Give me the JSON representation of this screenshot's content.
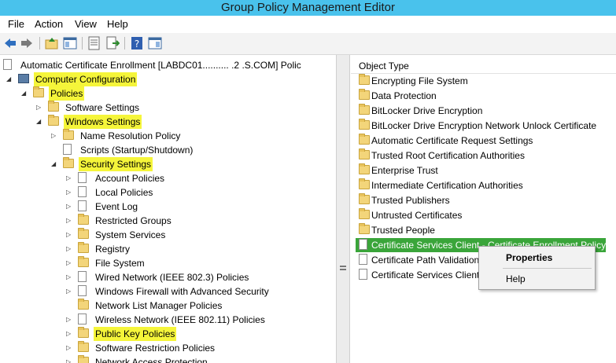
{
  "window": {
    "title": "Group Policy Management Editor"
  },
  "menu": [
    "File",
    "Action",
    "View",
    "Help"
  ],
  "toolbar": {
    "icons": [
      "back-icon",
      "forward-icon",
      "up-folder-icon",
      "show-hide-tree-icon",
      "properties-icon",
      "export-list-icon",
      "help-icon",
      "action-pane-icon"
    ]
  },
  "tree": {
    "root_label": "Automatic Certificate Enrollment [LABDC01.......... .2 .S.COM] Polic",
    "nodes": [
      {
        "label": "Computer Configuration",
        "highlight": true,
        "expanded": true,
        "icon": "computer-icon"
      },
      {
        "label": "Policies",
        "highlight": true,
        "expanded": true,
        "icon": "folder-icon"
      },
      {
        "label": "Software Settings",
        "highlight": false,
        "expanded": false,
        "icon": "folder-icon"
      },
      {
        "label": "Windows Settings",
        "highlight": true,
        "expanded": true,
        "icon": "folder-icon"
      },
      {
        "label": "Name Resolution Policy",
        "highlight": false,
        "expanded": false,
        "icon": "folder-icon"
      },
      {
        "label": "Scripts (Startup/Shutdown)",
        "highlight": false,
        "expanded": null,
        "icon": "script-icon"
      },
      {
        "label": "Security Settings",
        "highlight": true,
        "expanded": true,
        "icon": "security-icon"
      },
      {
        "label": "Account Policies",
        "highlight": false,
        "expanded": false,
        "icon": "policy-icon"
      },
      {
        "label": "Local Policies",
        "highlight": false,
        "expanded": false,
        "icon": "policy-icon"
      },
      {
        "label": "Event Log",
        "highlight": false,
        "expanded": false,
        "icon": "policy-icon"
      },
      {
        "label": "Restricted Groups",
        "highlight": false,
        "expanded": false,
        "icon": "lock-folder-icon"
      },
      {
        "label": "System Services",
        "highlight": false,
        "expanded": false,
        "icon": "lock-folder-icon"
      },
      {
        "label": "Registry",
        "highlight": false,
        "expanded": false,
        "icon": "lock-folder-icon"
      },
      {
        "label": "File System",
        "highlight": false,
        "expanded": false,
        "icon": "lock-folder-icon"
      },
      {
        "label": "Wired Network (IEEE 802.3) Policies",
        "highlight": false,
        "expanded": false,
        "icon": "network-icon"
      },
      {
        "label": "Windows Firewall with Advanced Security",
        "highlight": false,
        "expanded": false,
        "icon": "firewall-icon"
      },
      {
        "label": "Network List Manager Policies",
        "highlight": false,
        "expanded": null,
        "icon": "folder-icon"
      },
      {
        "label": "Wireless Network (IEEE 802.11) Policies",
        "highlight": false,
        "expanded": false,
        "icon": "wireless-icon"
      },
      {
        "label": "Public Key Policies",
        "highlight": true,
        "expanded": false,
        "icon": "folder-icon"
      },
      {
        "label": "Software Restriction Policies",
        "highlight": false,
        "expanded": false,
        "icon": "folder-icon"
      },
      {
        "label": "Network Access Protection",
        "highlight": false,
        "expanded": false,
        "icon": "folder-icon"
      }
    ]
  },
  "list": {
    "column_header": "Object Type",
    "items": [
      {
        "label": "Encrypting File System",
        "icon": "folder-icon"
      },
      {
        "label": "Data Protection",
        "icon": "folder-icon"
      },
      {
        "label": "BitLocker Drive Encryption",
        "icon": "folder-icon"
      },
      {
        "label": "BitLocker Drive Encryption Network Unlock Certificate",
        "icon": "folder-icon"
      },
      {
        "label": "Automatic Certificate Request Settings",
        "icon": "folder-icon"
      },
      {
        "label": "Trusted Root Certification Authorities",
        "icon": "folder-icon"
      },
      {
        "label": "Enterprise Trust",
        "icon": "folder-icon"
      },
      {
        "label": "Intermediate Certification Authorities",
        "icon": "folder-icon"
      },
      {
        "label": "Trusted Publishers",
        "icon": "folder-icon"
      },
      {
        "label": "Untrusted Certificates",
        "icon": "folder-icon"
      },
      {
        "label": "Trusted People",
        "icon": "folder-icon"
      },
      {
        "label": "Certificate Services Client - Certificate Enrollment Policy",
        "icon": "certificate-icon",
        "selected": true
      },
      {
        "label": "Certificate Path Validation",
        "icon": "certificate-icon"
      },
      {
        "label": "Certificate Services Client",
        "icon": "certificate-icon"
      }
    ]
  },
  "context_menu": {
    "properties_label": "Properties",
    "help_label": "Help"
  },
  "colors": {
    "title_bar": "#49c2ec",
    "highlight": "#f5f53a",
    "selection": "#3aa53a"
  }
}
